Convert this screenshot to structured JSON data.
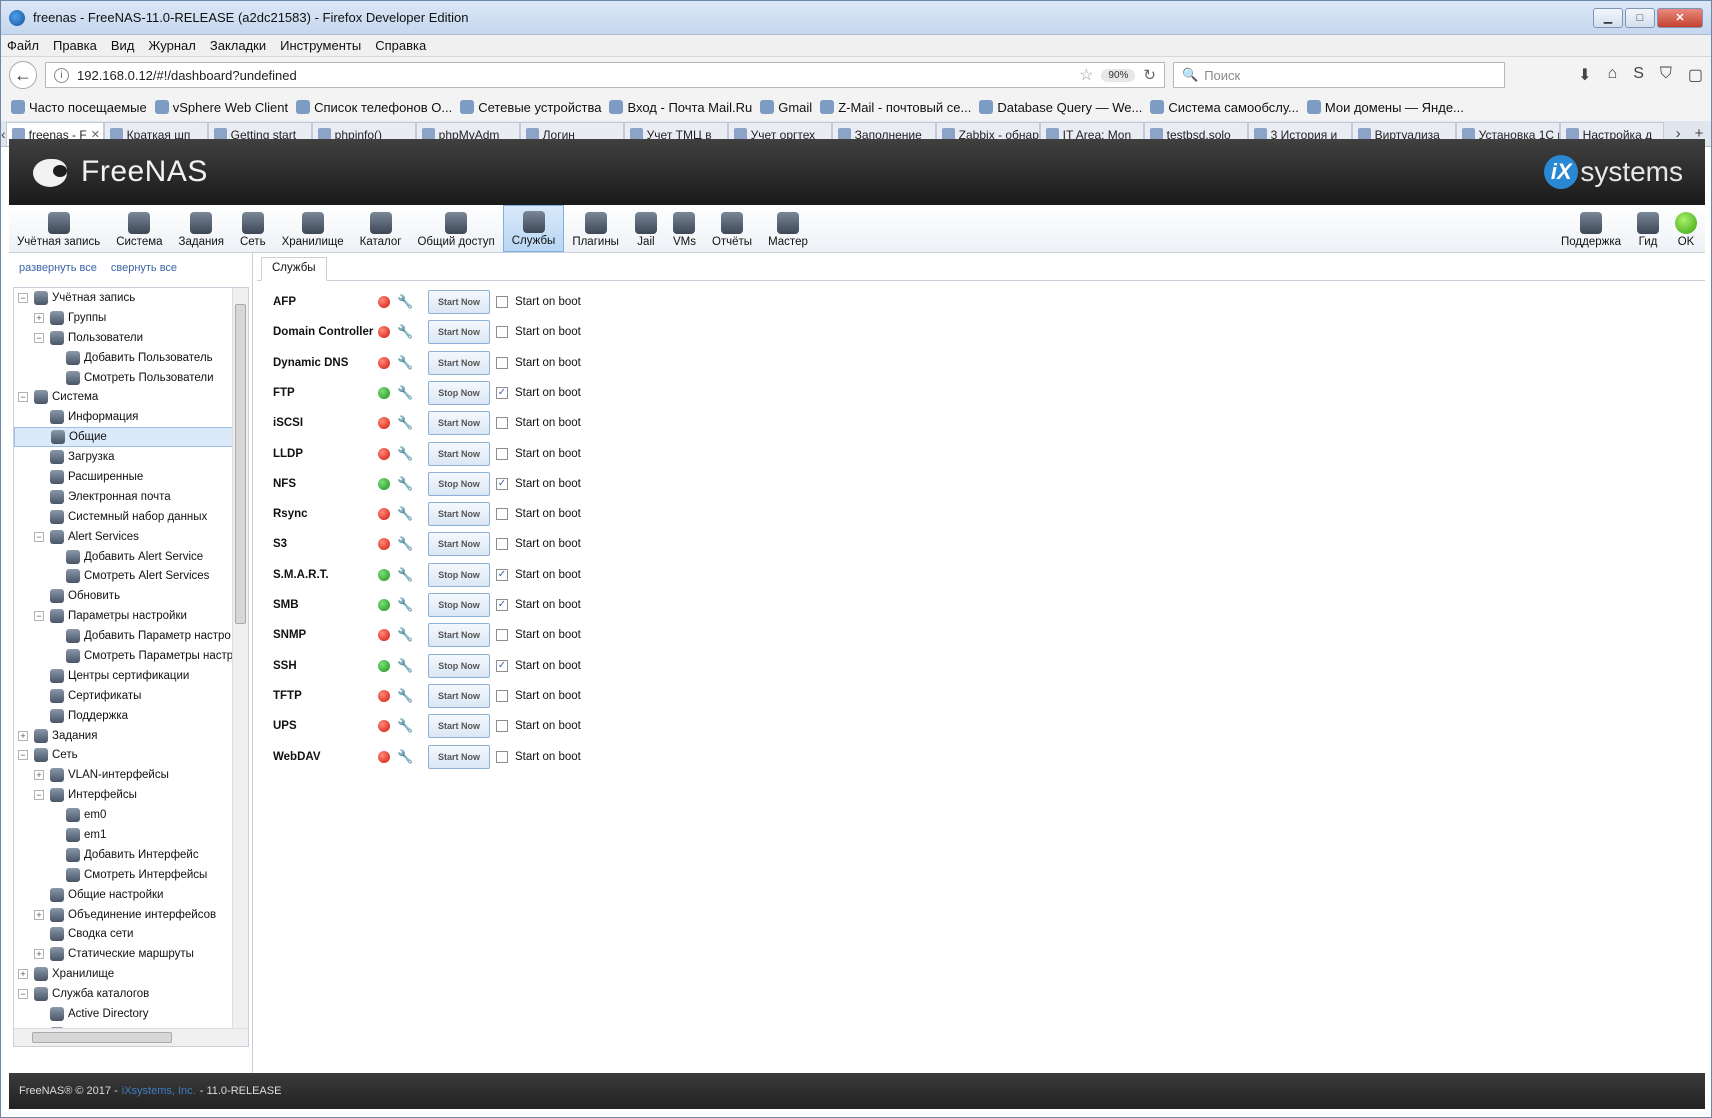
{
  "window": {
    "title": "freenas - FreeNAS-11.0-RELEASE (a2dc21583) - Firefox Developer Edition",
    "min": "▁",
    "max": "□",
    "close": "✕"
  },
  "menu": [
    "Файл",
    "Правка",
    "Вид",
    "Журнал",
    "Закладки",
    "Инструменты",
    "Справка"
  ],
  "nav": {
    "url": "192.168.0.12/#!/dashboard?undefined",
    "zoom": "90%",
    "search_placeholder": "Поиск",
    "icons": [
      "download-icon",
      "home-icon",
      "extension-icon",
      "ublock-icon",
      "pocket-icon"
    ]
  },
  "bookmarks": [
    "Часто посещаемые",
    "vSphere Web Client",
    "Список телефонов О...",
    "Сетевые устройства",
    "Вход - Почта Mail.Ru",
    "Gmail",
    "Z-Mail - почтовый се...",
    "Database Query — We...",
    "Система самообслу...",
    "Мои домены — Янде..."
  ],
  "tabs": [
    {
      "label": "freenas - F",
      "active": true
    },
    {
      "label": "Краткая шп"
    },
    {
      "label": "Getting start"
    },
    {
      "label": "phpinfo()"
    },
    {
      "label": "phpMyAdm"
    },
    {
      "label": "Логин"
    },
    {
      "label": "Учет ТМЦ в"
    },
    {
      "label": "Учет оргтех"
    },
    {
      "label": "Заполнение"
    },
    {
      "label": "Zabbix - обнар"
    },
    {
      "label": "IT Area: Mon"
    },
    {
      "label": "testbsd.solo"
    },
    {
      "label": "3 История и"
    },
    {
      "label": "Виртуализа"
    },
    {
      "label": "Установка 1С н"
    },
    {
      "label": "Настройка д"
    }
  ],
  "header": {
    "brand": "FreeNAS",
    "vendor": "systems",
    "vendor_mark": "iX"
  },
  "toolbar": [
    {
      "label": "Учётная запись",
      "icon": "account-icon"
    },
    {
      "label": "Система",
      "icon": "system-icon"
    },
    {
      "label": "Задания",
      "icon": "tasks-icon"
    },
    {
      "label": "Сеть",
      "icon": "network-icon"
    },
    {
      "label": "Хранилище",
      "icon": "storage-icon"
    },
    {
      "label": "Каталог",
      "icon": "directory-icon"
    },
    {
      "label": "Общий доступ",
      "icon": "sharing-icon"
    },
    {
      "label": "Службы",
      "icon": "services-icon",
      "active": true
    },
    {
      "label": "Плагины",
      "icon": "plugins-icon"
    },
    {
      "label": "Jail",
      "icon": "jail-icon"
    },
    {
      "label": "VMs",
      "icon": "vms-icon"
    },
    {
      "label": "Отчёты",
      "icon": "reports-icon"
    },
    {
      "label": "Мастер",
      "icon": "wizard-icon"
    }
  ],
  "toolbar_right": [
    {
      "label": "Поддержка",
      "icon": "support-icon"
    },
    {
      "label": "Гид",
      "icon": "guide-icon"
    },
    {
      "label": "OK",
      "icon": "ok-status-icon"
    }
  ],
  "sidebar": {
    "expand_all": "развернуть все",
    "collapse_all": "свернуть все",
    "tree": [
      {
        "label": "Учётная запись",
        "level": 0,
        "exp": "−"
      },
      {
        "label": "Группы",
        "level": 1,
        "exp": "+"
      },
      {
        "label": "Пользователи",
        "level": 1,
        "exp": "−"
      },
      {
        "label": "Добавить Пользователь",
        "level": 2
      },
      {
        "label": "Смотреть Пользователи",
        "level": 2
      },
      {
        "label": "Система",
        "level": 0,
        "exp": "−"
      },
      {
        "label": "Информация",
        "level": 1
      },
      {
        "label": "Общие",
        "level": 1,
        "selected": true
      },
      {
        "label": "Загрузка",
        "level": 1
      },
      {
        "label": "Расширенные",
        "level": 1
      },
      {
        "label": "Электронная почта",
        "level": 1
      },
      {
        "label": "Системный набор данных",
        "level": 1
      },
      {
        "label": "Alert Services",
        "level": 1,
        "exp": "−"
      },
      {
        "label": "Добавить Alert Service",
        "level": 2
      },
      {
        "label": "Смотреть Alert Services",
        "level": 2
      },
      {
        "label": "Обновить",
        "level": 1
      },
      {
        "label": "Параметры настройки",
        "level": 1,
        "exp": "−"
      },
      {
        "label": "Добавить Параметр настро",
        "level": 2
      },
      {
        "label": "Смотреть Параметры настр",
        "level": 2
      },
      {
        "label": "Центры сертификации",
        "level": 1
      },
      {
        "label": "Сертификаты",
        "level": 1
      },
      {
        "label": "Поддержка",
        "level": 1
      },
      {
        "label": "Задания",
        "level": 0,
        "exp": "+"
      },
      {
        "label": "Сеть",
        "level": 0,
        "exp": "−"
      },
      {
        "label": "VLAN-интерфейсы",
        "level": 1,
        "exp": "+"
      },
      {
        "label": "Интерфейсы",
        "level": 1,
        "exp": "−"
      },
      {
        "label": "em0",
        "level": 2
      },
      {
        "label": "em1",
        "level": 2
      },
      {
        "label": "Добавить Интерфейс",
        "level": 2
      },
      {
        "label": "Смотреть Интерфейсы",
        "level": 2
      },
      {
        "label": "Общие настройки",
        "level": 1
      },
      {
        "label": "Объединение интерфейсов",
        "level": 1,
        "exp": "+"
      },
      {
        "label": "Сводка сети",
        "level": 1
      },
      {
        "label": "Статические маршруты",
        "level": 1,
        "exp": "+"
      },
      {
        "label": "Хранилище",
        "level": 0,
        "exp": "+"
      },
      {
        "label": "Служба каталогов",
        "level": 0,
        "exp": "−"
      },
      {
        "label": "Active Directory",
        "level": 1
      },
      {
        "label": "LDAP",
        "level": 1
      }
    ]
  },
  "main": {
    "tab": "Службы",
    "start_on_boot_label": "Start on boot",
    "services": [
      {
        "name": "AFP",
        "running": false,
        "button": "Start Now",
        "boot": false
      },
      {
        "name": "Domain Controller",
        "running": false,
        "button": "Start Now",
        "boot": false
      },
      {
        "name": "Dynamic DNS",
        "running": false,
        "button": "Start Now",
        "boot": false
      },
      {
        "name": "FTP",
        "running": true,
        "button": "Stop Now",
        "boot": true
      },
      {
        "name": "iSCSI",
        "running": false,
        "button": "Start Now",
        "boot": false
      },
      {
        "name": "LLDP",
        "running": false,
        "button": "Start Now",
        "boot": false
      },
      {
        "name": "NFS",
        "running": true,
        "button": "Stop Now",
        "boot": true
      },
      {
        "name": "Rsync",
        "running": false,
        "button": "Start Now",
        "boot": false
      },
      {
        "name": "S3",
        "running": false,
        "button": "Start Now",
        "boot": false
      },
      {
        "name": "S.M.A.R.T.",
        "running": true,
        "button": "Stop Now",
        "boot": true
      },
      {
        "name": "SMB",
        "running": true,
        "button": "Stop Now",
        "boot": true
      },
      {
        "name": "SNMP",
        "running": false,
        "button": "Start Now",
        "boot": false
      },
      {
        "name": "SSH",
        "running": true,
        "button": "Stop Now",
        "boot": true
      },
      {
        "name": "TFTP",
        "running": false,
        "button": "Start Now",
        "boot": false
      },
      {
        "name": "UPS",
        "running": false,
        "button": "Start Now",
        "boot": false
      },
      {
        "name": "WebDAV",
        "running": false,
        "button": "Start Now",
        "boot": false
      }
    ]
  },
  "footer": {
    "copyright": "FreeNAS® © 2017 -",
    "company": "iXsystems, Inc.",
    "version": "- 11.0-RELEASE"
  }
}
